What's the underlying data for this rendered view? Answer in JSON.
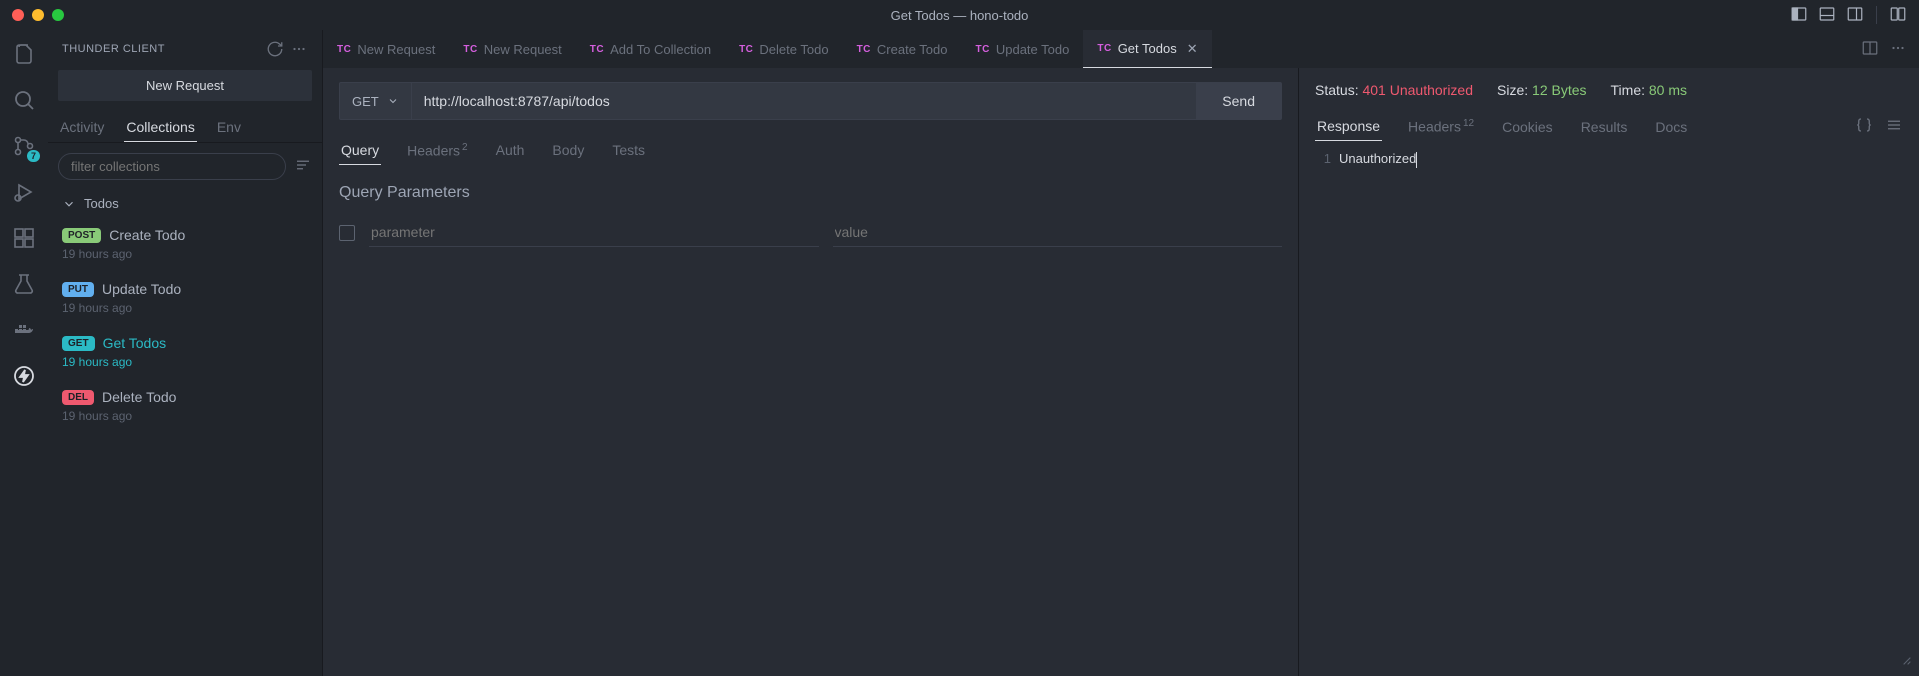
{
  "window": {
    "title": "Get Todos — hono-todo"
  },
  "activitybar": {
    "source_control_count": "7"
  },
  "sidebar": {
    "title": "THUNDER CLIENT",
    "new_request_label": "New Request",
    "tabs": [
      "Activity",
      "Collections",
      "Env"
    ],
    "active_tab": 1,
    "filter_placeholder": "filter collections",
    "collection": {
      "name": "Todos",
      "items": [
        {
          "method": "POST",
          "method_class": "m-post",
          "title": "Create Todo",
          "time": "19 hours ago",
          "active": false
        },
        {
          "method": "PUT",
          "method_class": "m-put",
          "title": "Update Todo",
          "time": "19 hours ago",
          "active": false
        },
        {
          "method": "GET",
          "method_class": "m-get",
          "title": "Get Todos",
          "time": "19 hours ago",
          "active": true
        },
        {
          "method": "DEL",
          "method_class": "m-del",
          "title": "Delete Todo",
          "time": "19 hours ago",
          "active": false
        }
      ]
    }
  },
  "tabs": [
    {
      "label": "New Request",
      "active": false
    },
    {
      "label": "New Request",
      "active": false
    },
    {
      "label": "Add To Collection",
      "active": false
    },
    {
      "label": "Delete Todo",
      "active": false
    },
    {
      "label": "Create Todo",
      "active": false
    },
    {
      "label": "Update Todo",
      "active": false
    },
    {
      "label": "Get Todos",
      "active": true
    }
  ],
  "request": {
    "method": "GET",
    "url": "http://localhost:8787/api/todos",
    "send_label": "Send",
    "tabs": {
      "query": "Query",
      "headers": "Headers",
      "headers_count": "2",
      "auth": "Auth",
      "body": "Body",
      "tests": "Tests"
    },
    "section_title": "Query Parameters",
    "param_placeholder": "parameter",
    "value_placeholder": "value"
  },
  "response": {
    "status_label": "Status:",
    "status_value": "401 Unauthorized",
    "size_label": "Size:",
    "size_value": "12 Bytes",
    "time_label": "Time:",
    "time_value": "80 ms",
    "tabs": {
      "response": "Response",
      "headers": "Headers",
      "headers_count": "12",
      "cookies": "Cookies",
      "results": "Results",
      "docs": "Docs"
    },
    "body_line_no": "1",
    "body_text": "Unauthorized"
  }
}
